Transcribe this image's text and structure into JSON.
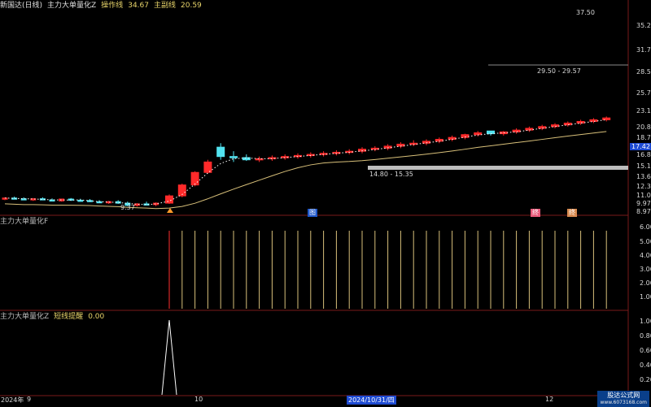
{
  "header_main": {
    "title": "新国达(日线)",
    "indicator": "主力大单量化Z",
    "label1": "操作线",
    "value1": "34.67",
    "label2": "主副线",
    "value2": "20.59"
  },
  "header_sub1": {
    "title": "主力大单量化F"
  },
  "header_sub2": {
    "title": "主力大单量化Z",
    "label": "短线提醒",
    "value": "0.00"
  },
  "main_axis_ticks": [
    "35.29",
    "31.76",
    "28.59",
    "25.73",
    "23.15",
    "20.84",
    "18.75",
    "17.42",
    "16.88",
    "15.19",
    "13.67",
    "12.30",
    "11.07",
    "9.97",
    "8.97"
  ],
  "sub1_axis_ticks": [
    "6.00",
    "5.00",
    "4.00",
    "3.00",
    "2.00",
    "1.00"
  ],
  "sub2_axis_ticks": [
    "1.00",
    "0.80",
    "0.60",
    "0.40",
    "0.20"
  ],
  "annotations": {
    "high_label": "37.50",
    "low_label": "9.37",
    "zone_label_mid": "29.50 - 29.57",
    "zone_label_low": "14.80 - 15.35",
    "current_price": "17.42"
  },
  "markers": {
    "m1": "图",
    "m2": "终",
    "m3": "终"
  },
  "bottom_axis": [
    "2024年",
    "9",
    "10",
    "2024/10/31/四",
    "12"
  ],
  "watermark": {
    "line1": "股达公式网",
    "line2": "www.6073168.com"
  },
  "colors": {
    "up": "#ff2a2a",
    "down": "#52e3f0",
    "ma": "#d8c07a",
    "zone": "#bdbdbd"
  },
  "chart_data": {
    "type": "candlestick",
    "candles": [
      [
        9.9,
        10.0,
        9.8,
        9.95
      ],
      [
        9.95,
        10.05,
        9.85,
        9.9
      ],
      [
        9.9,
        10.0,
        9.8,
        9.85
      ],
      [
        9.85,
        9.95,
        9.75,
        9.9
      ],
      [
        9.9,
        10.0,
        9.8,
        9.82
      ],
      [
        9.82,
        9.92,
        9.72,
        9.75
      ],
      [
        9.75,
        9.9,
        9.7,
        9.88
      ],
      [
        9.88,
        9.95,
        9.75,
        9.8
      ],
      [
        9.8,
        9.9,
        9.7,
        9.78
      ],
      [
        9.78,
        9.88,
        9.68,
        9.7
      ],
      [
        9.7,
        9.8,
        9.6,
        9.62
      ],
      [
        9.62,
        9.75,
        9.55,
        9.7
      ],
      [
        9.7,
        9.8,
        9.55,
        9.6
      ],
      [
        9.6,
        9.7,
        9.4,
        9.45
      ],
      [
        9.45,
        9.6,
        9.37,
        9.55
      ],
      [
        9.55,
        9.7,
        9.45,
        9.5
      ],
      [
        9.5,
        9.65,
        9.4,
        9.6
      ],
      [
        9.6,
        10.2,
        9.55,
        10.1
      ],
      [
        10.1,
        11.0,
        10.0,
        10.9
      ],
      [
        10.9,
        12.0,
        10.8,
        11.9
      ],
      [
        11.9,
        13.0,
        11.8,
        12.8
      ],
      [
        14.2,
        14.6,
        13.0,
        13.3
      ],
      [
        13.3,
        13.8,
        12.8,
        13.2
      ],
      [
        13.2,
        13.5,
        12.9,
        13.0
      ],
      [
        13.0,
        13.3,
        12.8,
        13.1
      ],
      [
        13.1,
        13.4,
        12.9,
        13.2
      ],
      [
        13.2,
        13.5,
        13.0,
        13.3
      ],
      [
        13.3,
        13.6,
        13.1,
        13.4
      ],
      [
        13.4,
        13.7,
        13.2,
        13.5
      ],
      [
        13.5,
        13.8,
        13.3,
        13.6
      ],
      [
        13.6,
        13.9,
        13.4,
        13.7
      ],
      [
        13.7,
        14.0,
        13.5,
        13.8
      ],
      [
        13.8,
        14.2,
        13.6,
        14.0
      ],
      [
        14.0,
        14.3,
        13.8,
        14.1
      ],
      [
        14.1,
        14.5,
        13.9,
        14.3
      ],
      [
        14.3,
        14.7,
        14.1,
        14.5
      ],
      [
        14.5,
        14.9,
        14.3,
        14.6
      ],
      [
        14.6,
        15.0,
        14.4,
        14.8
      ],
      [
        14.8,
        15.2,
        14.6,
        15.0
      ],
      [
        15.0,
        15.4,
        14.8,
        15.2
      ],
      [
        15.2,
        15.6,
        15.0,
        15.5
      ],
      [
        15.5,
        15.9,
        15.3,
        15.7
      ],
      [
        15.9,
        15.9,
        15.4,
        15.6
      ],
      [
        15.6,
        15.9,
        15.4,
        15.8
      ],
      [
        15.8,
        16.2,
        15.6,
        16.0
      ],
      [
        16.0,
        16.4,
        15.8,
        16.2
      ],
      [
        16.2,
        16.6,
        16.0,
        16.4
      ],
      [
        16.4,
        16.8,
        16.2,
        16.6
      ],
      [
        16.6,
        17.0,
        16.4,
        16.8
      ],
      [
        16.8,
        17.2,
        16.6,
        17.0
      ],
      [
        17.0,
        17.4,
        16.8,
        17.2
      ],
      [
        17.2,
        17.6,
        17.0,
        17.42
      ]
    ],
    "ylim": [
      8.97,
      36.5
    ]
  }
}
